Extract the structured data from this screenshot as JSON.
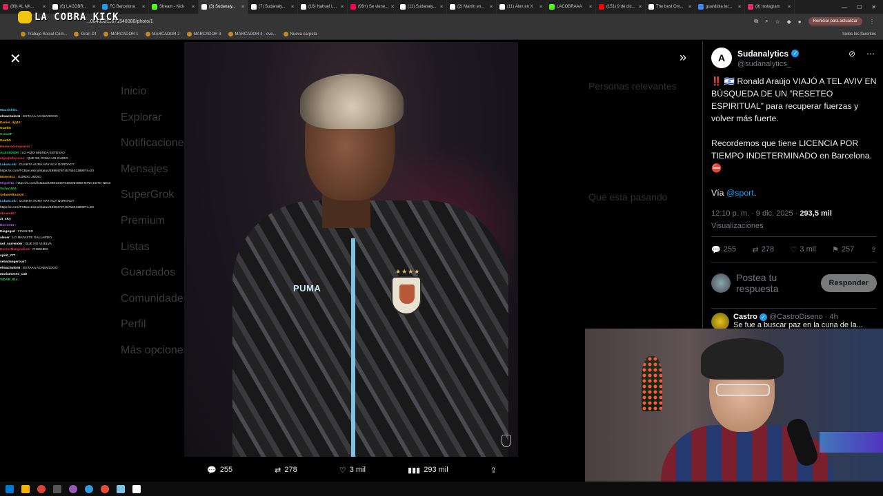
{
  "browser": {
    "tabs": [
      {
        "label": "(89) AL NA...",
        "color": "#e0245e",
        "active": false
      },
      {
        "label": "(6) LACOBR...",
        "color": "#ffffff",
        "active": false
      },
      {
        "label": "FC Barcelona",
        "color": "#1d9bf0",
        "active": false
      },
      {
        "label": "Stream - Kick",
        "color": "#53fc18",
        "active": false
      },
      {
        "label": "(3) Sudanaly...",
        "color": "#ffffff",
        "active": true
      },
      {
        "label": "(7) Sudanaly...",
        "color": "#ffffff",
        "active": false
      },
      {
        "label": "(16) Nahuel L...",
        "color": "#ffffff",
        "active": false
      },
      {
        "label": "(99+) Se viene...",
        "color": "#ff0050",
        "active": false
      },
      {
        "label": "(11) Sudanaly...",
        "color": "#ffffff",
        "active": false
      },
      {
        "label": "(2) Martín en...",
        "color": "#ffffff",
        "active": false
      },
      {
        "label": "(11) Álex en X",
        "color": "#ffffff",
        "active": false
      },
      {
        "label": "LACOBRAAA",
        "color": "#53fc18",
        "active": false
      },
      {
        "label": "(151) 9 de dic...",
        "color": "#ff0000",
        "active": false
      },
      {
        "label": "The best Chr...",
        "color": "#ffffff",
        "active": false
      },
      {
        "label": "guardiola ter...",
        "color": "#4285f4",
        "active": false
      },
      {
        "label": "(9) Instagram",
        "color": "#e1306c",
        "active": false
      }
    ],
    "stream_logo": "LA COBRA KICK",
    "url": "...0840981167154838​8/photo/1",
    "update_button": "Reiniciar para actualizar",
    "bookmarks": [
      "Trabajo Social Com...",
      "Gran DT",
      "MARCADOR 1",
      "MARCADOR 2",
      "MARCADOR 3",
      "MARCADOR 4 - ove...",
      "Nueva carpeta"
    ],
    "all_favorites": "Todos los favoritos"
  },
  "background_nav": {
    "items": [
      "Inicio",
      "Explorar",
      "Notificaciones",
      "Mensajes",
      "SuperGrok",
      "Premium",
      "Listas",
      "Guardados",
      "Comunidades",
      "Perfil",
      "Más opciones"
    ],
    "right_headings": [
      "Personas relevantes",
      "Qué está pasando"
    ]
  },
  "photo_actions": {
    "replies": "255",
    "reposts": "278",
    "likes": "3 mil",
    "views": "293 mil"
  },
  "chat": [
    {
      "user": "MaurinhOL",
      "color": "#5ac8fa",
      "msg": ""
    },
    {
      "user": "elmachulon5",
      "color": "#ffffff",
      "msg": "ESTAAA ACABADOOO"
    },
    {
      "user": "Daniel_djq10",
      "color": "#ff9f0a",
      "msg": ""
    },
    {
      "user": "GustiG",
      "color": "#ffd60a",
      "msg": ""
    },
    {
      "user": "CrowdF",
      "color": "#30d158",
      "msg": ""
    },
    {
      "user": "GustiG",
      "color": "#ffd60a",
      "msg": ""
    },
    {
      "user": "Homerocrimposrro",
      "color": "#ff453a",
      "msg": ""
    },
    {
      "user": "ALEXISSDR",
      "color": "#30d158",
      "msg": "LO HIZO MIERDA ESTEVAO"
    },
    {
      "user": "elgordofornoso",
      "color": "#ff375f",
      "msg": "QUE SE COMA UN GUISO"
    },
    {
      "user": "LukasLoki",
      "color": "#5ac8fa",
      "msg": "CUANTA AURA HAY ACA GORDAO?"
    },
    {
      "user": "",
      "color": "#ffffff",
      "msg": "https://x.com/FCBarcelona/status/1998478745754013898?s=20"
    },
    {
      "user": "Mateo912",
      "color": "#ff9f0a",
      "msg": "GORDO JUDIO"
    },
    {
      "user": "Miguel11",
      "color": "#bf5af2",
      "msg": "https://x.com/i/status/1998144670403284669 MIRA ESTO NENE"
    },
    {
      "user": "Vicho1504",
      "color": "#30d158",
      "msg": ""
    },
    {
      "user": "SebasAlbum30",
      "color": "#ff9f0a",
      "msg": ""
    },
    {
      "user": "LukasLoki",
      "color": "#5ac8fa",
      "msg": "CUANTA AURA HAY ACA GORDAO?"
    },
    {
      "user": "",
      "color": "#ffffff",
      "msg": "https://x.com/FCBarcelona/status/1998478745754013898?s=20"
    },
    {
      "user": "ohcaio84",
      "color": "#ff453a",
      "msg": ""
    },
    {
      "user": "ZI_sKy",
      "color": "#ffffff",
      "msg": ""
    },
    {
      "user": "Boris014",
      "color": "#bf5af2",
      "msg": ""
    },
    {
      "user": "Diegoqsd",
      "color": "#ffffff",
      "msg": "FINISHED"
    },
    {
      "user": "alexer",
      "color": "#ffffff",
      "msg": "LO MATASTE GALLARDO"
    },
    {
      "user": "not_surrender",
      "color": "#ffffff",
      "msg": "QUE NO VUELVA"
    },
    {
      "user": "DoctorMangoxlose",
      "color": "#ff375f",
      "msg": "FINISHED"
    },
    {
      "user": "spirit_777",
      "color": "#ffffff",
      "msg": ""
    },
    {
      "user": "sebadangerous7",
      "color": "#ffffff",
      "msg": ""
    },
    {
      "user": "elmachulon5",
      "color": "#ffffff",
      "msg": "ESTAAA ACABADOOO"
    },
    {
      "user": "mariamosen_cab",
      "color": "#ffffff",
      "msg": ""
    },
    {
      "user": "VIDAR_814",
      "color": "#30d158",
      "msg": ""
    }
  ],
  "post": {
    "display_name": "Sudanalytics",
    "handle": "@sudanalytics_",
    "paragraph1": "‼️ 🇮🇱 Ronald Araújo VIAJÓ A TEL AVIV EN BÚSQUEDA DE UN “RESETEO ESPIRITUAL” para recuperar fuerzas y volver más fuerte.",
    "paragraph2": "Recordemos que tiene LICENCIA POR TIEMPO INDETERMINADO en Barcelona. ⛔",
    "via_prefix": "Vía ",
    "via_link": "@sport",
    "via_suffix": ".",
    "timestamp": "12:10 p. m. · 9 dic. 2025 · ",
    "views_count": "293,5 mil",
    "views_label": "Visualizaciones",
    "replies": "255",
    "reposts": "278",
    "likes": "3 mil",
    "bookmarks": "257",
    "reply_placeholder": "Postea tu respuesta",
    "reply_button": "Responder"
  },
  "next_reply": {
    "name": "Castro",
    "handle": "@CastroDiseno · 4h",
    "text": "Se fue a buscar paz en la cuna de la..."
  },
  "photo": {
    "brand": "PUMA",
    "crest_stars": "★★★★"
  }
}
